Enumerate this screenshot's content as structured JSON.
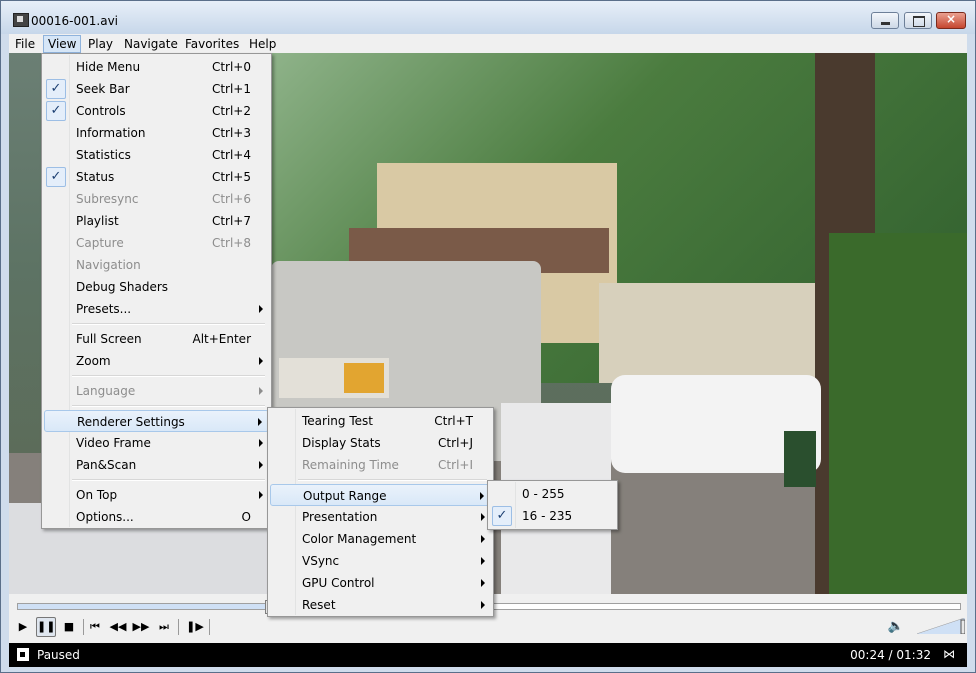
{
  "window": {
    "title": "00016-001.avi"
  },
  "menubar": [
    {
      "label": "File"
    },
    {
      "label": "View",
      "active": true
    },
    {
      "label": "Play"
    },
    {
      "label": "Navigate"
    },
    {
      "label": "Favorites"
    },
    {
      "label": "Help"
    }
  ],
  "view_menu": [
    {
      "label": "Hide Menu",
      "shortcut": "Ctrl+0"
    },
    {
      "label": "Seek Bar",
      "shortcut": "Ctrl+1",
      "checked": true
    },
    {
      "label": "Controls",
      "shortcut": "Ctrl+2",
      "checked": true
    },
    {
      "label": "Information",
      "shortcut": "Ctrl+3"
    },
    {
      "label": "Statistics",
      "shortcut": "Ctrl+4"
    },
    {
      "label": "Status",
      "shortcut": "Ctrl+5",
      "checked": true
    },
    {
      "label": "Subresync",
      "shortcut": "Ctrl+6",
      "disabled": true
    },
    {
      "label": "Playlist",
      "shortcut": "Ctrl+7"
    },
    {
      "label": "Capture",
      "shortcut": "Ctrl+8",
      "disabled": true
    },
    {
      "label": "Navigation",
      "disabled": true
    },
    {
      "label": "Debug Shaders"
    },
    {
      "label": "Presets...",
      "submenu": true
    },
    {
      "label": "Full Screen",
      "shortcut": "Alt+Enter"
    },
    {
      "label": "Zoom",
      "submenu": true
    },
    {
      "label": "Language",
      "submenu": true,
      "disabled": true
    },
    {
      "label": "Renderer Settings",
      "submenu": true,
      "highlighted": true
    },
    {
      "label": "Video Frame",
      "submenu": true
    },
    {
      "label": "Pan&Scan",
      "submenu": true
    },
    {
      "label": "On Top",
      "submenu": true
    },
    {
      "label": "Options...",
      "shortcut": "O"
    }
  ],
  "renderer_menu": [
    {
      "label": "Tearing Test",
      "shortcut": "Ctrl+T"
    },
    {
      "label": "Display Stats",
      "shortcut": "Ctrl+J"
    },
    {
      "label": "Remaining Time",
      "shortcut": "Ctrl+I",
      "disabled": true
    },
    {
      "label": "Output Range",
      "submenu": true,
      "highlighted": true
    },
    {
      "label": "Presentation",
      "submenu": true
    },
    {
      "label": "Color Management",
      "submenu": true
    },
    {
      "label": "VSync",
      "submenu": true
    },
    {
      "label": "GPU Control",
      "submenu": true
    },
    {
      "label": "Reset",
      "submenu": true
    }
  ],
  "output_range_menu": [
    {
      "label": "0 - 255"
    },
    {
      "label": "16 - 235",
      "checked": true
    }
  ],
  "check_glyph": "✓",
  "controls": {
    "play_glyph": "▶",
    "pause_glyph": "❚❚",
    "stop_glyph": "■",
    "prev_glyph": "⏮",
    "rewind_glyph": "◀◀",
    "forward_glyph": "▶▶",
    "next_glyph": "⏭",
    "frame_step_glyph": "❚▶",
    "volume_glyph": "🔈",
    "seek_progress": 0.265,
    "volume_level": 1.0
  },
  "status": {
    "text": "Paused",
    "time": "00:24 / 01:32"
  }
}
